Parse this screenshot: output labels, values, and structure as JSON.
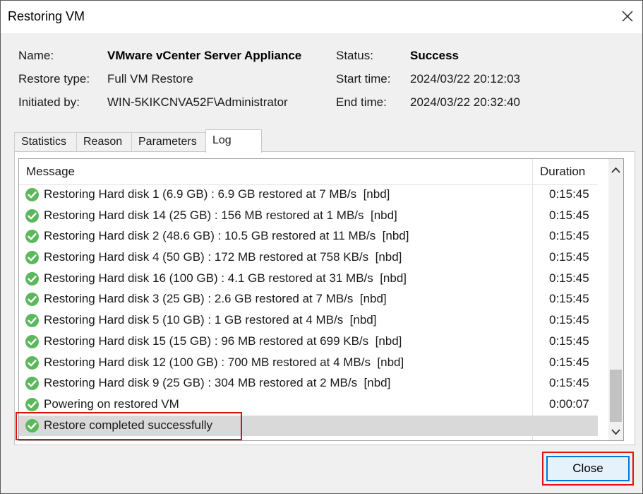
{
  "window": {
    "title": "Restoring VM"
  },
  "info": {
    "name_label": "Name:",
    "name_value": "VMware vCenter Server Appliance",
    "restore_type_label": "Restore type:",
    "restore_type_value": "Full VM Restore",
    "initiated_by_label": "Initiated by:",
    "initiated_by_value": "WIN-5KIKCNVA52F\\Administrator",
    "status_label": "Status:",
    "status_value": "Success",
    "start_time_label": "Start time:",
    "start_time_value": "2024/03/22 20:12:03",
    "end_time_label": "End time:",
    "end_time_value": "2024/03/22 20:32:40"
  },
  "tabs": [
    {
      "label": "Statistics"
    },
    {
      "label": "Reason"
    },
    {
      "label": "Parameters"
    },
    {
      "label": "Log",
      "active": true
    }
  ],
  "log": {
    "columns": {
      "message": "Message",
      "duration": "Duration"
    },
    "rows": [
      {
        "message": "Restoring Hard disk 1 (6.9 GB) : 6.9 GB restored at 7 MB/s  [nbd]",
        "duration": "0:15:45",
        "icon": "success-check-icon"
      },
      {
        "message": "Restoring Hard disk 14 (25 GB) : 156 MB restored at 1 MB/s  [nbd]",
        "duration": "0:15:45",
        "icon": "success-check-icon"
      },
      {
        "message": "Restoring Hard disk 2 (48.6 GB) : 10.5 GB restored at 11 MB/s  [nbd]",
        "duration": "0:15:45",
        "icon": "success-check-icon"
      },
      {
        "message": "Restoring Hard disk 4 (50 GB) : 172 MB restored at 758 KB/s  [nbd]",
        "duration": "0:15:45",
        "icon": "success-check-icon"
      },
      {
        "message": "Restoring Hard disk 16 (100 GB) : 4.1 GB restored at 31 MB/s  [nbd]",
        "duration": "0:15:45",
        "icon": "success-check-icon"
      },
      {
        "message": "Restoring Hard disk 3 (25 GB) : 2.6 GB restored at 7 MB/s  [nbd]",
        "duration": "0:15:45",
        "icon": "success-check-icon"
      },
      {
        "message": "Restoring Hard disk 5 (10 GB) : 1 GB restored at 4 MB/s  [nbd]",
        "duration": "0:15:45",
        "icon": "success-check-icon"
      },
      {
        "message": "Restoring Hard disk 15 (15 GB) : 96 MB restored at 699 KB/s  [nbd]",
        "duration": "0:15:45",
        "icon": "success-check-icon"
      },
      {
        "message": "Restoring Hard disk 12 (100 GB) : 700 MB restored at 4 MB/s  [nbd]",
        "duration": "0:15:45",
        "icon": "success-check-icon"
      },
      {
        "message": "Restoring Hard disk 9 (25 GB) : 304 MB restored at 2 MB/s  [nbd]",
        "duration": "0:15:45",
        "icon": "success-check-icon"
      },
      {
        "message": "Powering on restored VM",
        "duration": "0:00:07",
        "icon": "success-check-icon"
      },
      {
        "message": "Restore completed successfully",
        "duration": "",
        "icon": "success-check-icon",
        "selected": true
      }
    ]
  },
  "buttons": {
    "close_label": "Close"
  },
  "colors": {
    "success_green": "#5cb85c",
    "highlight_red": "#e01010",
    "button_focus_blue": "#0078d7"
  }
}
